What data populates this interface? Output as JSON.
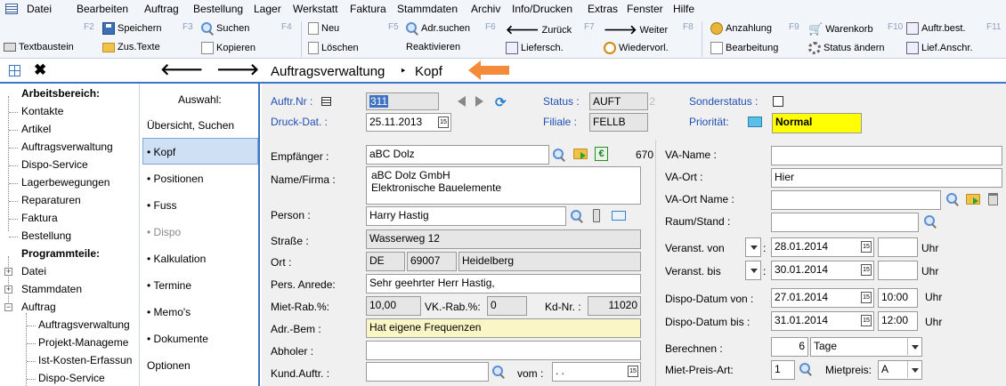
{
  "menu": [
    "Datei",
    "Bearbeiten",
    "Auftrag",
    "Bestellung",
    "Lager",
    "Werkstatt",
    "Faktura",
    "Stammdaten",
    "Archiv",
    "Info/Drucken",
    "Extras",
    "Fenster",
    "Hilfe"
  ],
  "toolbar": {
    "fkeys": [
      "F2",
      "F3",
      "F4",
      "F5",
      "F6",
      "F7",
      "F8",
      "F9",
      "F10",
      "F11"
    ],
    "row1": [
      "Speichern",
      "Suchen",
      "Neu",
      "Adr.suchen",
      "Zurück",
      "Weiter",
      "Anzahlung",
      "Warenkorb",
      "Auftr.best."
    ],
    "row2": [
      "Textbaustein",
      "Zus.Texte",
      "Kopieren",
      "Löschen",
      "Reaktivieren",
      "Liefersch.",
      "Wiedervorl.",
      "Bearbeitung",
      "Status ändern",
      "Lief.Anschr."
    ]
  },
  "nav": {
    "section": "Auftragsverwaltung",
    "separator": "‣",
    "page": "Kopf"
  },
  "tree": {
    "workspace_label": "Arbeitsbereich:",
    "workspace": [
      "Kontakte",
      "Artikel",
      "Auftragsverwaltung",
      "Dispo-Service",
      "Lagerbewegungen",
      "Reparaturen",
      "Faktura",
      "Bestellung"
    ],
    "modules_label": "Programmteile:",
    "modules": [
      "Datei",
      "Stammdaten",
      "Auftrag"
    ],
    "auftrag_children": [
      "Auftragsverwaltung",
      "Projekt-Manageme",
      "Ist-Kosten-Erfassun",
      "Dispo-Service"
    ]
  },
  "selection": {
    "heading": "Auswahl:",
    "items": [
      "Übersicht, Suchen",
      "• Kopf",
      "• Positionen",
      "• Fuss",
      "• Dispo",
      "• Kalkulation",
      "• Termine",
      "• Memo's",
      "• Dokumente",
      "Optionen"
    ]
  },
  "form": {
    "auftr_nr_label": "Auftr.Nr :",
    "auftr_nr": "311",
    "druck_dat_label": "Druck-Dat. :",
    "druck_dat": "25.11.2013",
    "status_label": "Status :",
    "status": "AUFT",
    "status_num": "2",
    "filiale_label": "Filiale :",
    "filiale": "FELLB",
    "sonderstatus_label": "Sonderstatus :",
    "prioritaet_label": "Priorität:",
    "prioritaet": "Normal",
    "empfaenger_label": "Empfänger :",
    "empfaenger": "aBC Dolz",
    "empfaenger_nr": "670",
    "name_label": "Name/Firma :",
    "name_line1": "aBC Dolz GmbH",
    "name_line2": "Elektronische Bauelemente",
    "person_label": "Person :",
    "person": "Harry Hastig",
    "strasse_label": "Straße :",
    "strasse": "Wasserweg 12",
    "ort_label": "Ort :",
    "land": "DE",
    "plz": "69007",
    "ort": "Heidelberg",
    "anrede_label": "Pers. Anrede:",
    "anrede": "Sehr geehrter Herr Hastig,",
    "mietrab_label": "Miet-Rab.%:",
    "mietrab": "10,00",
    "vkrab_label": "VK.-Rab.%:",
    "vkrab": "0",
    "kdnr_label": "Kd-Nr. :",
    "kdnr": "11020",
    "adrbem_label": "Adr.-Bem :",
    "adrbem": "Hat eigene Frequenzen",
    "abholer_label": "Abholer :",
    "abholer": "",
    "kundauftr_label": "Kund.Auftr. :",
    "kundauftr": "",
    "vom_label": "vom :",
    "vom": " .  .",
    "vaname_label": "VA-Name :",
    "vaname": "",
    "vaort_label": "VA-Ort :",
    "vaort": "Hier",
    "vaortname_label": "VA-Ort Name :",
    "vaortname": "",
    "raum_label": "Raum/Stand :",
    "raum": "",
    "veranst_von_label": "Veranst. von",
    "veranst_von": "28.01.2014",
    "veranst_bis_label": "Veranst. bis",
    "veranst_bis": "30.01.2014",
    "uhr": "Uhr",
    "dispo_von_label": "Dispo-Datum von :",
    "dispo_von": "27.01.2014",
    "dispo_von_time": "10:00",
    "dispo_bis_label": "Dispo-Datum bis :",
    "dispo_bis": "31.01.2014",
    "dispo_bis_time": "12:00",
    "berechnen_label": "Berechnen :",
    "berechnen_num": "6",
    "berechnen_unit": "Tage",
    "mietpreisart_label": "Miet-Preis-Art:",
    "mietpreisart": "1",
    "mietpreis_label": "Mietpreis:",
    "mietpreis": "A"
  },
  "colors": {
    "accent": "#3c76c7",
    "priority": "#ffff00",
    "arrow": "#f58a3a"
  }
}
